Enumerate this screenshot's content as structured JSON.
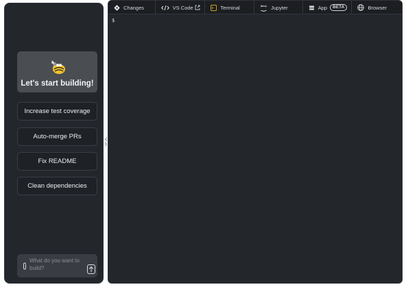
{
  "sidebar": {
    "hero": {
      "title": "Let's start building!",
      "logo_icon": "mascot-logo-icon"
    },
    "actions": [
      {
        "label": "Increase test coverage"
      },
      {
        "label": "Auto-merge PRs"
      },
      {
        "label": "Fix README"
      },
      {
        "label": "Clean dependencies"
      }
    ],
    "prompt": {
      "placeholder": "What do you want to build?",
      "value": ""
    }
  },
  "tabs": [
    {
      "label": "Changes",
      "icon": "git-diamond-icon"
    },
    {
      "label": "VS Code",
      "icon": "code-brackets-icon",
      "secondary_icon": "external-link-icon"
    },
    {
      "label": "Terminal",
      "icon": "terminal-icon"
    },
    {
      "label": "Jupyter",
      "icon": "jupyter-icon"
    },
    {
      "label": "App",
      "icon": "grid-app-icon",
      "badge": "BETA"
    },
    {
      "label": "Browser",
      "icon": "globe-icon"
    }
  ],
  "terminal": {
    "prompt": "$"
  },
  "colors": {
    "panel_bg": "#23262b",
    "tab_bg": "#1c1e22",
    "hero_bg": "#4a4d52",
    "accent_yellow": "#f2c12e",
    "terminal_icon_yellow": "#c9a227"
  }
}
